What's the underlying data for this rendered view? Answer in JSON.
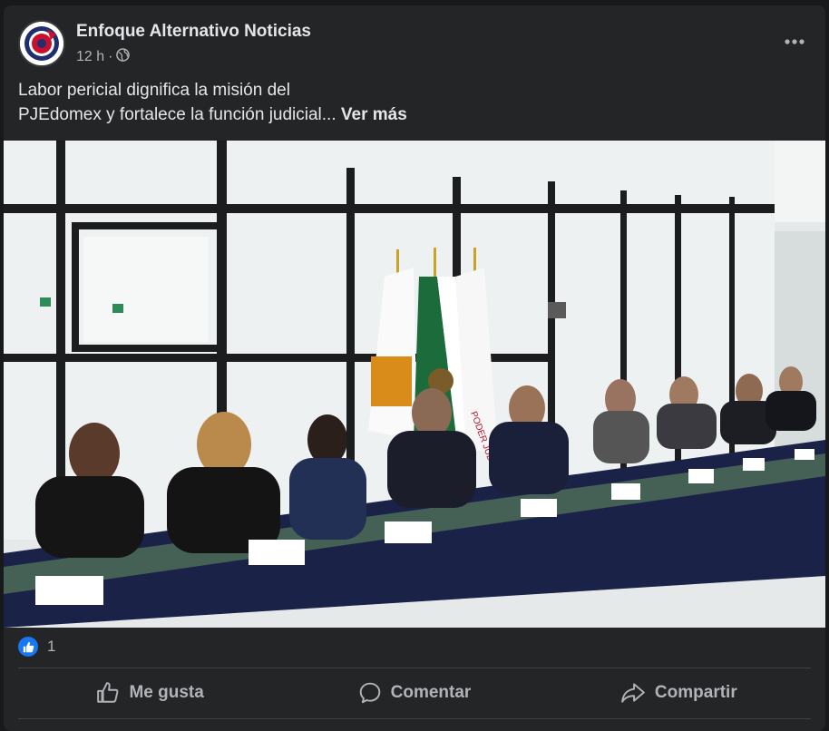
{
  "post": {
    "page_name": "Enfoque Alternativo Noticias",
    "timestamp": "12 h",
    "separator": "·",
    "audience_icon": "globe-icon",
    "more_icon": "more-horizontal-icon",
    "caption_line1": "Labor pericial dignifica la misión del",
    "caption_line2": "PJEdomex y fortalece la función judicial...",
    "see_more": "Ver más",
    "photo": {
      "alt": "",
      "flag_seal_text": "PODER JUDICIAL"
    },
    "reactions": {
      "icon": "like-reaction-icon",
      "count": "1"
    },
    "actions": {
      "like": "Me gusta",
      "comment": "Comentar",
      "share": "Compartir"
    }
  },
  "colors": {
    "background": "#18191a",
    "card": "#242526",
    "primary_text": "#e4e6eb",
    "secondary_text": "#b0b3b8",
    "accent": "#1877f2",
    "divider": "#3e4042"
  }
}
